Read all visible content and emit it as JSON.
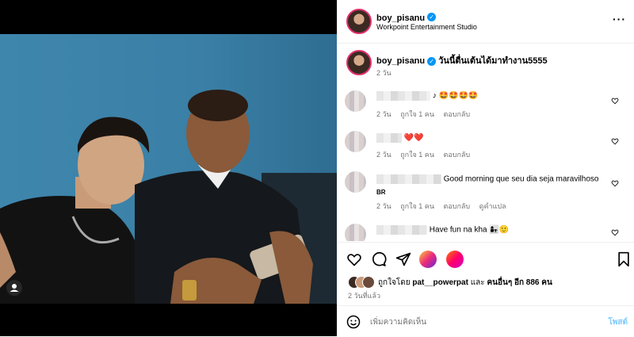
{
  "header": {
    "username": "boy_pisanu",
    "location": "Workpoint Entertainment Studio",
    "more_icon": "more-horizontal-icon"
  },
  "caption": {
    "username": "boy_pisanu",
    "text": "วันนี้ตื่นเต้นได้มาทำงาน5555",
    "time": "2 วัน"
  },
  "comments": [
    {
      "text": "♪ 🤩🤩🤩🤩",
      "time": "2 วัน",
      "likes": "ถูกใจ 1 คน",
      "reply": "ตอบกลับ"
    },
    {
      "text": "❤️❤️",
      "time": "2 วัน",
      "likes": "ถูกใจ 1 คน",
      "reply": "ตอบกลับ"
    },
    {
      "text": "Good morning que seu dia seja maravilhoso",
      "sub": "BR",
      "time": "2 วัน",
      "likes": "ถูกใจ 1 คน",
      "reply": "ตอบกลับ",
      "translate": "ดูคำแปล"
    },
    {
      "text": "Have fun na kha 👩‍👧🙂"
    }
  ],
  "actions": {
    "liked_by_prefix": "ถูกใจโดย",
    "liked_by_user": "pat__powerpat",
    "and_others": "และ",
    "others_count": "คนอื่นๆ อีก 886 คน",
    "posted_ago": "2 วันที่แล้ว"
  },
  "composer": {
    "placeholder": "เพิ่มความคิดเห็น",
    "post_label": "โพสต์"
  },
  "colors": {
    "accent": "#0095f6",
    "muted": "#737373",
    "like_red": "#ed4956"
  }
}
